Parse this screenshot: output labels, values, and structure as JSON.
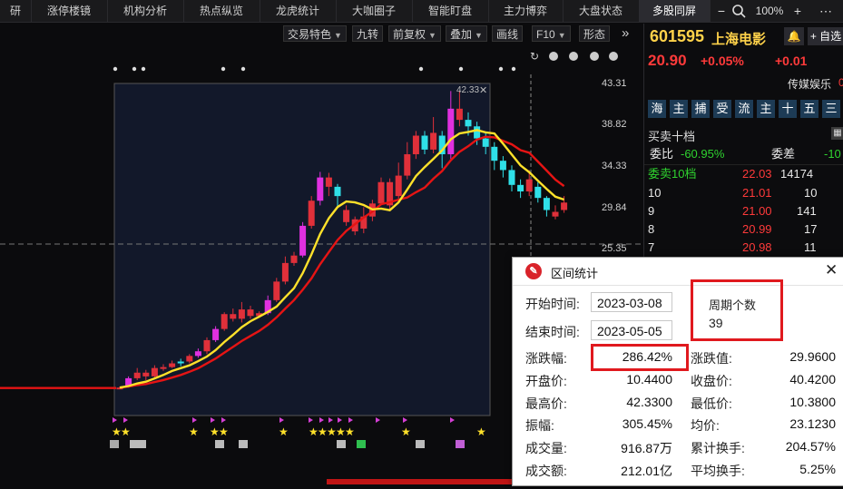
{
  "nav": {
    "tabs": [
      "研",
      "涨停楼镜",
      "机构分析",
      "热点纵览",
      "龙虎统计",
      "大咖圈子",
      "智能盯盘",
      "主力博弈",
      "大盘状态",
      "多股同屏"
    ],
    "active": "多股同屏",
    "minus": "−",
    "zoom": "100%",
    "plus": "+",
    "options": "⋯"
  },
  "toolbar": {
    "buttons": [
      "交易特色",
      "九转",
      "前复权",
      "叠加",
      "画线",
      "F10",
      "形态"
    ],
    "expand": "»"
  },
  "chart": {
    "price_labels": [
      "43.31",
      "38.82",
      "34.33",
      "29.84",
      "25.35"
    ],
    "peak_label": "42.33",
    "colors": {
      "up": "#e0303a",
      "down": "#2fe0e8",
      "magenta": "#e030e0",
      "ma_short": "#ffe12a",
      "ma_long": "#e61414"
    }
  },
  "quote": {
    "code": "601595",
    "name": "上海电影",
    "alert_icon": "bell-icon",
    "add_label": "+ 自选",
    "last": "20.90",
    "chg_pct": "+0.05%",
    "chg": "+0.01",
    "sector": "传媒娱乐",
    "sector_extra": "0",
    "quick_buttons": [
      "海",
      "主",
      "捕",
      "受",
      "流",
      "主",
      "十",
      "五",
      "三"
    ],
    "section_title": "买卖十档",
    "ratio_label": "委比",
    "ratio_value": "-60.95%",
    "diff_label": "委差",
    "diff_value": "-10",
    "ask10_label": "委卖10档",
    "ask10_price": "22.03",
    "ask10_vol": "14174",
    "asks": [
      {
        "level": "10",
        "price": "21.01",
        "vol": "10"
      },
      {
        "level": "9",
        "price": "21.00",
        "vol": "141"
      },
      {
        "level": "8",
        "price": "20.99",
        "vol": "17"
      },
      {
        "level": "7",
        "price": "20.98",
        "vol": "11"
      }
    ]
  },
  "popup": {
    "title": "区间统计",
    "start_label": "开始时间:",
    "start_value": "2023-03-08",
    "end_label": "结束时间:",
    "end_value": "2023-05-05",
    "period_label": "周期个数",
    "period_value": "39",
    "rows": [
      {
        "l1": "涨跌幅:",
        "v1": "286.42%",
        "l2": "涨跌值:",
        "v2": "29.9600"
      },
      {
        "l1": "开盘价:",
        "v1": "10.4400",
        "l2": "收盘价:",
        "v2": "40.4200"
      },
      {
        "l1": "最高价:",
        "v1": "42.3300",
        "l2": "最低价:",
        "v2": "10.3800"
      },
      {
        "l1": "振幅:",
        "v1": "305.45%",
        "l2": "均价:",
        "v2": "23.1230"
      },
      {
        "l1": "成交量:",
        "v1": "916.87万",
        "l2": "累计换手:",
        "v2": "204.57%"
      },
      {
        "l1": "成交额:",
        "v1": "212.01亿",
        "l2": "平均换手:",
        "v2": "5.25%"
      }
    ]
  }
}
